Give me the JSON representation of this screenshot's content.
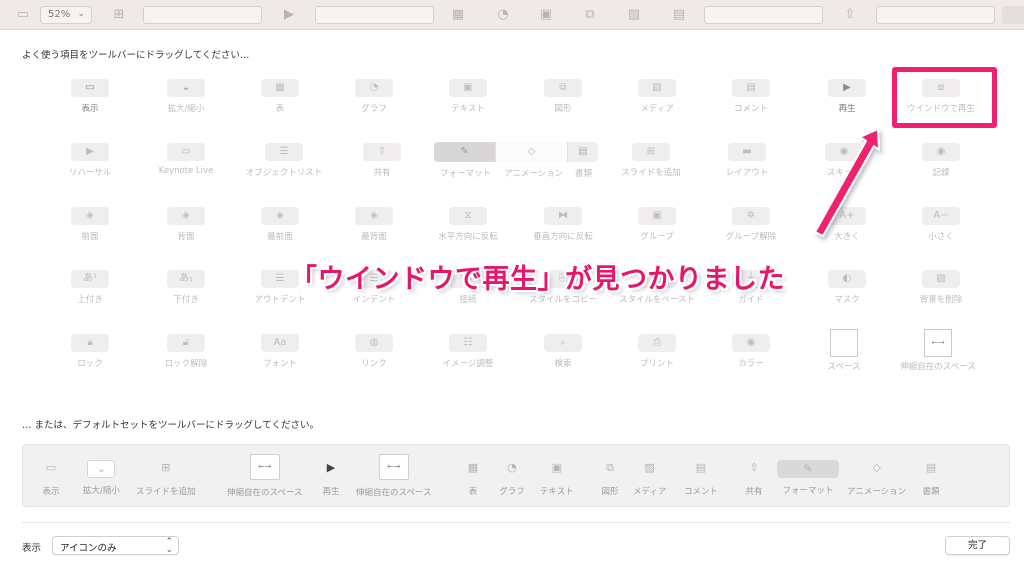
{
  "toolbar": {
    "zoom": "52%"
  },
  "headings": {
    "palette": "よく使う項目をツールバーにドラッグしてください…",
    "default_set": "… または、デフォルトセットをツールバーにドラッグしてください。"
  },
  "palette": {
    "row1": [
      "表示",
      "拡大/縮小",
      "表",
      "グラフ",
      "テキスト",
      "図形",
      "メディア",
      "コメント",
      "再生",
      "ウインドウで再生"
    ],
    "row2": [
      "リハーサル",
      "Keynote Live",
      "オブジェクトリスト",
      "共有",
      "フォーマット",
      "アニメーション",
      "書類",
      "スライドを追加",
      "レイアウト",
      "スキップ",
      "記録"
    ],
    "row3": [
      "前面",
      "背面",
      "最前面",
      "最背面",
      "水平方向に反転",
      "垂直方向に反転",
      "グループ",
      "グループ解除",
      "大きく",
      "小さく"
    ],
    "row4": [
      "上付き",
      "下付き",
      "アウトデント",
      "インデント",
      "接続",
      "スタイルをコピー",
      "スタイルをペースト",
      "ガイド",
      "マスク",
      "背景を削除"
    ],
    "row5": [
      "ロック",
      "ロック解除",
      "フォント",
      "リンク",
      "イメージ調整",
      "検索",
      "プリント",
      "カラー",
      "スペース",
      "伸縮自在のスペース"
    ]
  },
  "callout": "「ウインドウで再生」が見つかりました",
  "default_set": [
    "表示",
    "拡大/縮小",
    "スライドを追加",
    "伸縮自在のスペース",
    "再生",
    "伸縮自在のスペース",
    "表",
    "グラフ",
    "テキスト",
    "図形",
    "メディア",
    "コメント",
    "共有",
    "フォーマット",
    "アニメーション",
    "書類"
  ],
  "bottom": {
    "show_label": "表示",
    "show_value": "アイコンのみ",
    "done": "完了"
  },
  "colors": {
    "highlight": "#f0226f",
    "callout_text": "#e8166a"
  }
}
